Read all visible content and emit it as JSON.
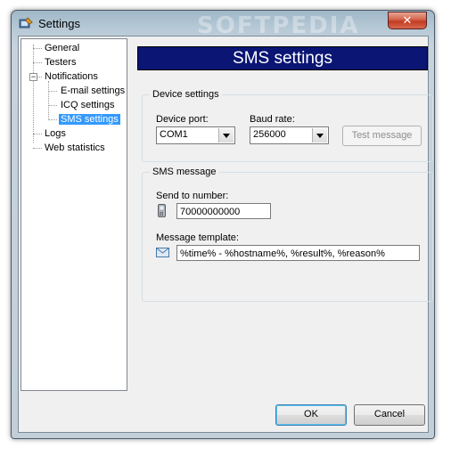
{
  "window": {
    "title": "Settings",
    "close_label": "✕",
    "watermark": "SOFTPEDIA"
  },
  "tree": {
    "items": [
      {
        "label": "General"
      },
      {
        "label": "Testers"
      },
      {
        "label": "Notifications"
      },
      {
        "label": "E-mail settings"
      },
      {
        "label": "ICQ settings"
      },
      {
        "label": "SMS settings"
      },
      {
        "label": "Logs"
      },
      {
        "label": "Web statistics"
      }
    ],
    "expander": "−"
  },
  "page": {
    "banner": "SMS settings",
    "device_group": {
      "title": "Device settings",
      "port_label": "Device port:",
      "port_value": "COM1",
      "baud_label": "Baud rate:",
      "baud_value": "256000",
      "test_button": "Test message"
    },
    "sms_group": {
      "title": "SMS message",
      "send_to_label": "Send to number:",
      "send_to_value": "70000000000",
      "template_label": "Message template:",
      "template_value": "%time% - %hostname%, %result%, %reason%"
    }
  },
  "footer": {
    "ok_label": "OK",
    "cancel_label": "Cancel"
  },
  "colors": {
    "banner_bg": "#0a1574",
    "selection": "#3399ff",
    "close_button": "#c13b22"
  },
  "icons": {
    "app": "settings-app-icon",
    "phone": "mobile-phone-icon",
    "mail": "envelope-icon"
  }
}
